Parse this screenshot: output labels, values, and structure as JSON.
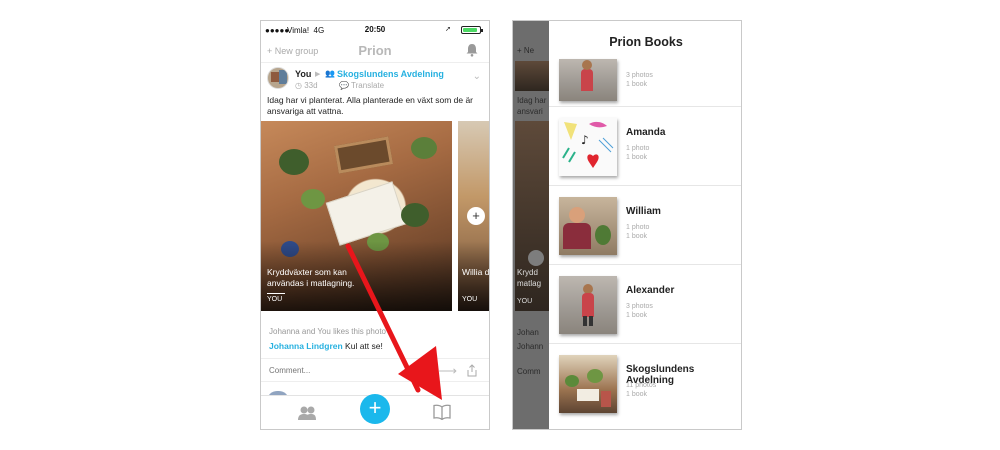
{
  "left_phone": {
    "status": {
      "carrier": "Vimla!",
      "network": "4G",
      "time": "20:50"
    },
    "header": {
      "new_group": "+ New group",
      "title": "Prion"
    },
    "post": {
      "author": "You",
      "group": "Skogslundens Avdelning",
      "age": "33d",
      "translate": "Translate",
      "text": "Idag har vi planterat. Alla planterade en växt som de är ansvariga att vattna.",
      "photo_caption": "Kryddväxter som kan användas i matlagning.",
      "photo_user": "YOU",
      "side_caption": "Willia den fö",
      "side_user": "YOU",
      "likes": "Johanna and You likes this photo",
      "comment_author": "Johanna Lindgren",
      "comment_text": "Kul att se!",
      "comment_placeholder": "Comment..."
    },
    "tabbar": {
      "add_label": "+"
    }
  },
  "right_phone": {
    "drawer_title": "Prion Books",
    "ghost_lines": [
      "+ Ne",
      "Idag har",
      "ansvari",
      "Krydd",
      "matlag",
      "YOU",
      "Johan",
      "Johann",
      "Comm"
    ],
    "books": [
      {
        "name": "",
        "photos": "3 photos",
        "books": "1 book"
      },
      {
        "name": "Amanda",
        "photos": "1 photo",
        "books": "1 book"
      },
      {
        "name": "William",
        "photos": "1 photo",
        "books": "1 book"
      },
      {
        "name": "Alexander",
        "photos": "3 photos",
        "books": "1 book"
      },
      {
        "name": "Skogslundens Avdelning",
        "photos": "11 photos",
        "books": "1 book"
      }
    ]
  },
  "colors": {
    "accent": "#1bb8ec",
    "link": "#27b1e0",
    "arrow": "#e8161b",
    "overlay": "#6d6d6d"
  },
  "icons": [
    "bell-icon",
    "group-icon",
    "chevron-down-icon",
    "send-arrow-icon",
    "share-icon",
    "people-icon",
    "plus-icon",
    "book-icon"
  ]
}
